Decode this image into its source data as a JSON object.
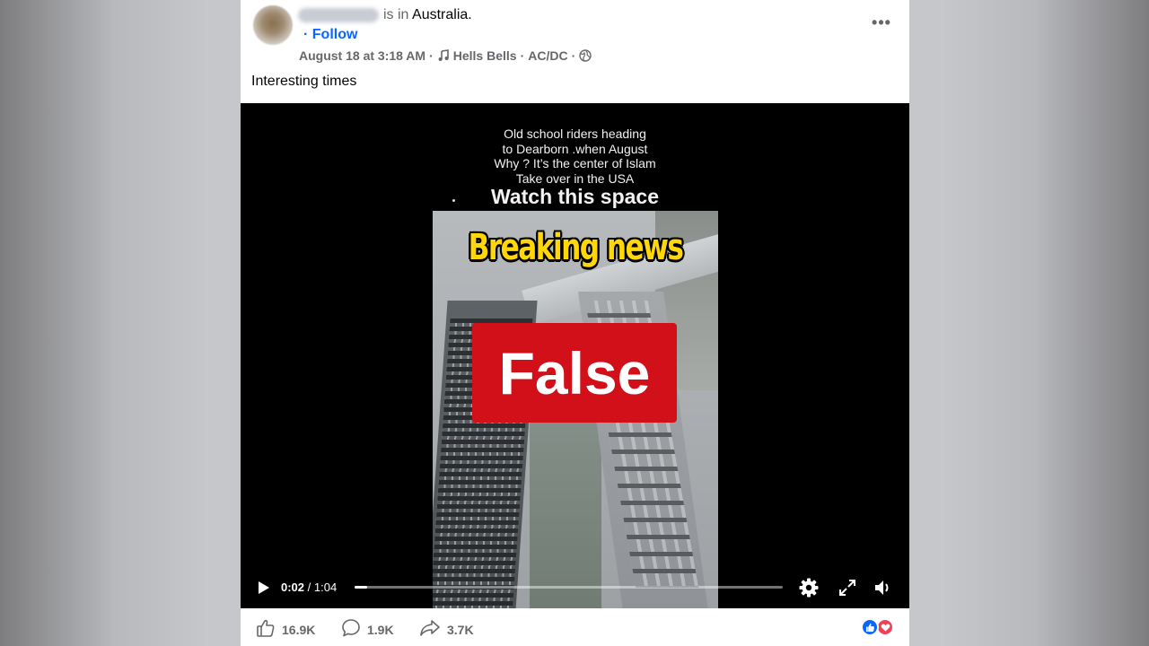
{
  "post": {
    "location_prefix": "is in",
    "location": "Australia",
    "location_suffix": ".",
    "follow": "· Follow",
    "date": "August 18 at 3:18 AM",
    "separator": "·",
    "song": "Hells Bells",
    "artist": "AC/DC",
    "caption": "Interesting times",
    "more_label": "•••"
  },
  "video": {
    "overlay_lines": [
      "Old school riders heading",
      "to Dearborn .when August",
      "Why ? It’s the center of Islam",
      "Take over in the USA"
    ],
    "watch_text": "Watch this space",
    "headline": "Breaking news",
    "fact_check_label": "False",
    "current_time": "0:02",
    "time_divider": "/",
    "duration": "1:04",
    "progress_fraction": 0.03
  },
  "reactions": {
    "likes": "16.9K",
    "comments": "1.9K",
    "shares": "3.7K"
  },
  "colors": {
    "follow_blue": "#0866ff",
    "false_red": "#d1101a",
    "breaking_yellow": "#ffd60a",
    "like_blue": "#0866ff",
    "love_red": "#f33e58"
  },
  "icons": [
    "globe-icon",
    "music-note-icon",
    "play-icon",
    "settings-gear-icon",
    "fullscreen-icon",
    "volume-icon",
    "like-icon",
    "comment-icon",
    "share-icon",
    "like-reaction-icon",
    "love-reaction-icon"
  ]
}
